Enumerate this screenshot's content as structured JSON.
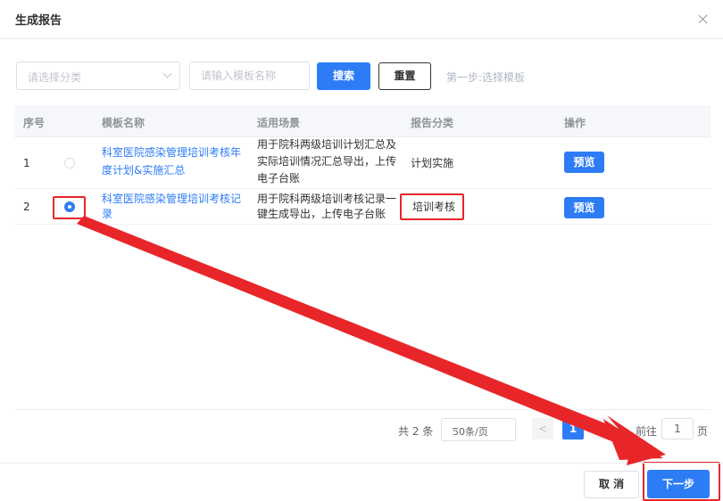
{
  "dialog": {
    "title": "生成报告"
  },
  "toolbar": {
    "category_placeholder": "请选择分类",
    "name_placeholder": "请输入模板名称",
    "search_label": "搜索",
    "reset_label": "重置",
    "step_hint": "第一步:选择模板"
  },
  "table": {
    "headers": [
      "序号",
      "模板名称",
      "适用场景",
      "报告分类",
      "操作"
    ],
    "rows": [
      {
        "index": "1",
        "selected": false,
        "name_line1": "科室医院感染管理培训考核年",
        "name_line2": "度计划&实施汇总",
        "scene_line1": "用于院科两级培训计划汇总及",
        "scene_line2": "实际培训情况汇总导出，上传",
        "scene_line3": "电子台账",
        "category": "计划实施",
        "action": "预览"
      },
      {
        "index": "2",
        "selected": true,
        "name_line1": "科室医院感染管理培训考核记",
        "name_line2": "录",
        "scene_line1": "用于院科两级培训考核记录一",
        "scene_line2": "键生成导出，上传电子台账",
        "category": "培训考核",
        "action": "预览"
      }
    ]
  },
  "pagination": {
    "total": "共 2 条",
    "page_size": "50条/页",
    "prev": "<",
    "current_page": "1",
    "goto_label": "前往",
    "goto_value": "1",
    "page_suffix": "页"
  },
  "footer": {
    "cancel_label": "取 消",
    "next_label": "下一步"
  },
  "colors": {
    "primary": "#2d7cf6",
    "annotation_red": "#e8262a"
  },
  "icons": {
    "close": "close-icon",
    "dropdown": "chevron-down-icon"
  }
}
